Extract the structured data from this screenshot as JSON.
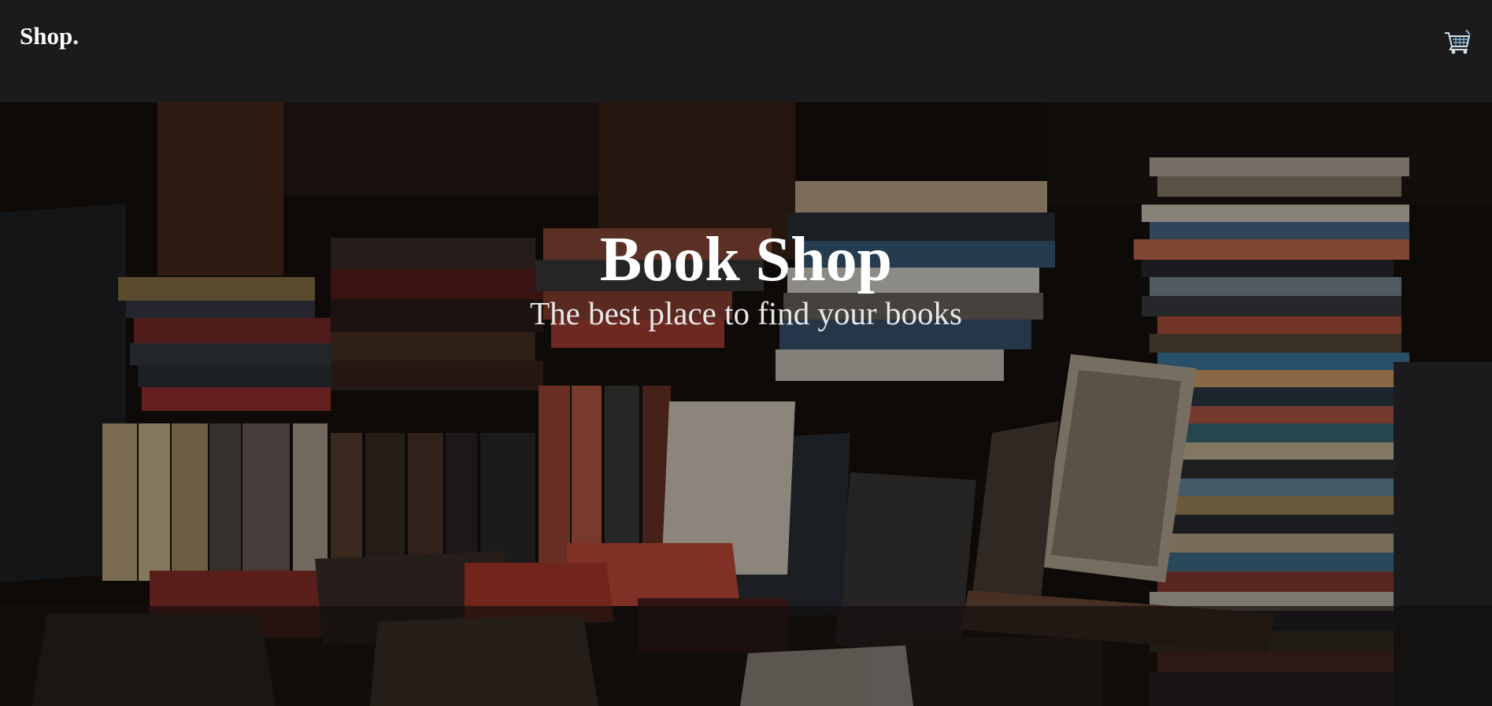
{
  "navbar": {
    "brand": "Shop.",
    "cart_icon": "shopping-cart-icon"
  },
  "hero": {
    "title": "Book Shop",
    "subtitle": "The best place to find your books",
    "background": "bookshop-photo"
  },
  "colors": {
    "navbar_bg": "#1b1b1b",
    "title_text": "#ffffff",
    "cart_accent": "#7fb6d8"
  }
}
